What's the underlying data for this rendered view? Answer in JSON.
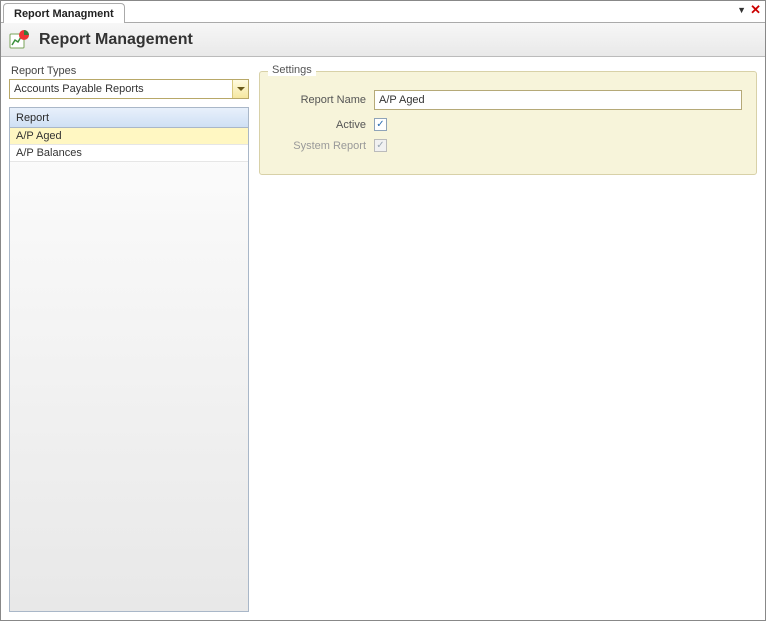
{
  "tab": {
    "title": "Report Managment"
  },
  "header": {
    "title": "Report Management"
  },
  "reportTypes": {
    "label": "Report Types",
    "selected": "Accounts Payable Reports"
  },
  "grid": {
    "header": "Report",
    "rows": [
      {
        "name": "A/P Aged",
        "selected": true
      },
      {
        "name": "A/P Balances",
        "selected": false
      }
    ]
  },
  "settings": {
    "legend": "Settings",
    "reportNameLabel": "Report Name",
    "reportNameValue": "A/P Aged",
    "activeLabel": "Active",
    "activeChecked": true,
    "systemReportLabel": "System Report",
    "systemReportChecked": true,
    "systemReportDisabled": true
  }
}
